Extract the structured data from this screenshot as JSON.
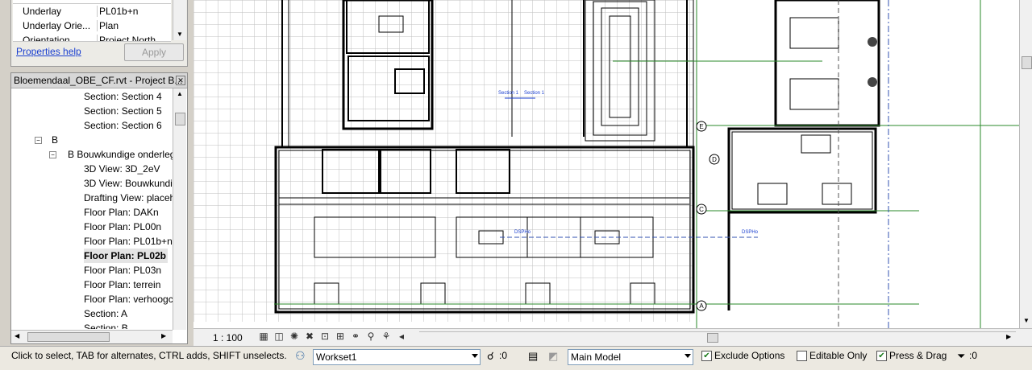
{
  "properties": {
    "rows": [
      {
        "name": "Underlay",
        "value": "PL01b+n"
      },
      {
        "name": "Underlay Orie...",
        "value": "Plan"
      },
      {
        "name": "Orientation",
        "value": "Project North"
      }
    ],
    "help_label": "Properties help",
    "apply_label": "Apply"
  },
  "browser": {
    "title": "Bloemendaal_OBE_CF.rvt - Project B...",
    "items": [
      {
        "label": "Section: Section 4"
      },
      {
        "label": "Section: Section 5"
      },
      {
        "label": "Section: Section 6"
      },
      {
        "label": "B"
      },
      {
        "label": "B Bouwkundige onderleg"
      },
      {
        "label": "3D View: 3D_2eV"
      },
      {
        "label": "3D View: Bouwkundi"
      },
      {
        "label": "Drafting View: placeh"
      },
      {
        "label": "Floor Plan: DAKn"
      },
      {
        "label": "Floor Plan: PL00n"
      },
      {
        "label": "Floor Plan: PL01b+n"
      },
      {
        "label": "Floor Plan: PL02b"
      },
      {
        "label": "Floor Plan: PL03n"
      },
      {
        "label": "Floor Plan: terrein"
      },
      {
        "label": "Floor Plan: verhoogc"
      },
      {
        "label": "Section: A"
      },
      {
        "label": "Section: B"
      }
    ]
  },
  "view": {
    "scale": "1 : 100",
    "section_labels": [
      "Section 1",
      "Section 1"
    ],
    "tag_labels": [
      "DSPHo",
      "DSPHo"
    ],
    "grid_labels": [
      "E",
      "D",
      "C",
      "A"
    ]
  },
  "status": {
    "message": "Click to select, TAB for alternates, CTRL adds, SHIFT unselects.",
    "workset": "Workset1",
    "worksets_count": ":0",
    "design_option": "Main Model",
    "exclude_options_label": "Exclude Options",
    "editable_only_label": "Editable Only",
    "press_drag_label": "Press & Drag",
    "filter_count": ":0"
  },
  "colors": {
    "accent": "#1a3fd0",
    "grid_green": "#2a8a2a",
    "grid_blue": "#3050b0"
  }
}
